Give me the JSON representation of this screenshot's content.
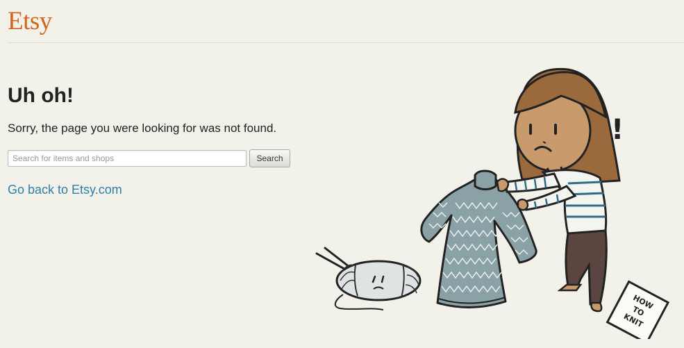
{
  "header": {
    "logo_text": "Etsy"
  },
  "main": {
    "heading": "Uh oh!",
    "message": "Sorry, the page you were looking for was not found.",
    "search": {
      "placeholder": "Search for items and shops",
      "value": "",
      "button_label": "Search"
    },
    "back_link": "Go back to Etsy.com"
  },
  "illustration": {
    "exclamation": "!",
    "booklet_lines": [
      "HOW",
      "TO",
      "KNIT"
    ]
  },
  "colors": {
    "background": "#f2f2ea",
    "brand": "#d5641c",
    "link": "#2d81a8",
    "text": "#222222"
  }
}
